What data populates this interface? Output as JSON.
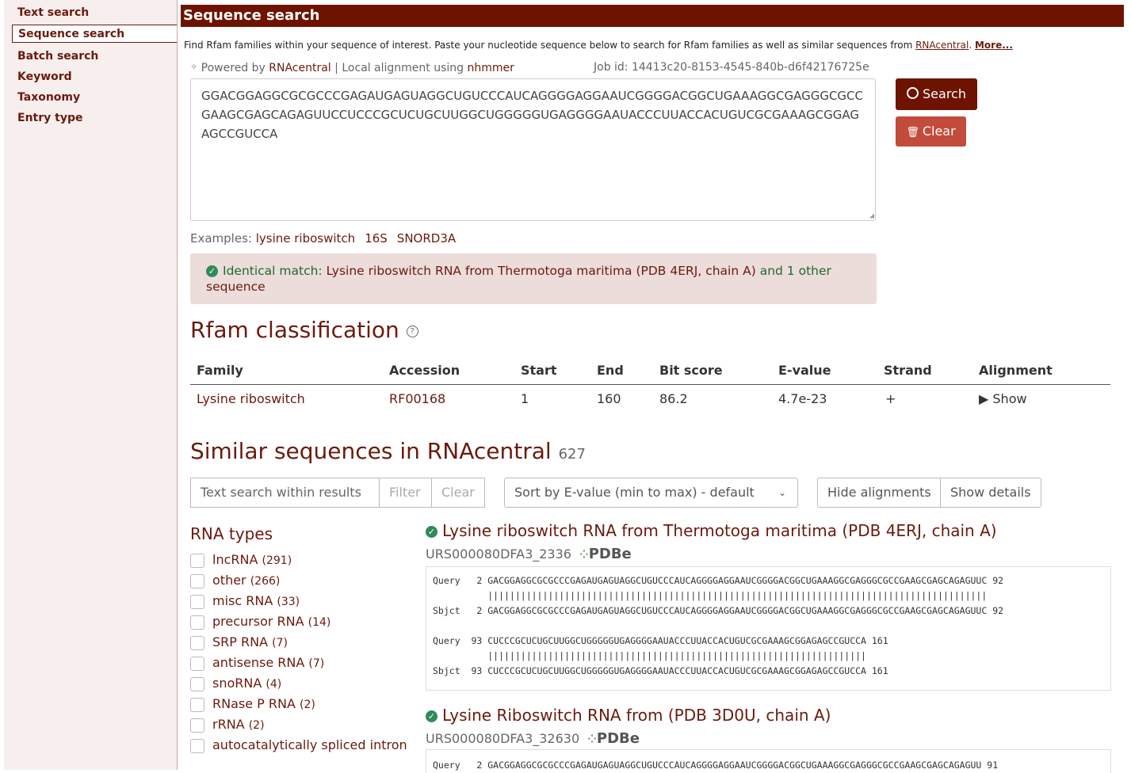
{
  "sidebar": {
    "items": [
      {
        "label": "Text search"
      },
      {
        "label": "Sequence search"
      },
      {
        "label": "Batch search"
      },
      {
        "label": "Keyword"
      },
      {
        "label": "Taxonomy"
      },
      {
        "label": "Entry type"
      }
    ],
    "active_index": 1
  },
  "header": {
    "title": "Sequence search"
  },
  "intro": {
    "text": "Find Rfam families within your sequence of interest. Paste your nucleotide sequence below to search for Rfam families as well as similar sequences from ",
    "link": "RNAcentral",
    "after_link": ". ",
    "more": "More..."
  },
  "powered": {
    "prefix": "Powered by ",
    "rnacentral": "RNAcentral",
    "separator": " | Local alignment using ",
    "nhmmer": "nhmmer"
  },
  "job_id": "Job id: 14413c20-8153-4545-840b-d6f42176725e",
  "sequence_input": {
    "value": "GGACGGAGGCGCGCCCGAGAUGAGUAGGCUGUCCCAUCAGGGGAGGAAUCGGGGACGGCUGAAAGGCGAGGGCGCCGAAGCGAGCAGAGUUCCUCCCGCUCUGCUUGGCUGGGGGUGAGGGGAAUACCCUUACCACUGUCGCGAAAGCGGAGAGCCGUCCA"
  },
  "buttons": {
    "search": "Search",
    "clear": "Clear"
  },
  "examples": {
    "label": "Examples:",
    "items": [
      "lysine riboswitch",
      "16S",
      "SNORD3A"
    ]
  },
  "match": {
    "prefix": "Identical match:",
    "description": "Lysine riboswitch RNA from Thermotoga maritima (PDB 4ERJ, chain A)",
    "suffix": "and 1 other",
    "tail": "sequence"
  },
  "classification": {
    "title": "Rfam classification",
    "columns": [
      "Family",
      "Accession",
      "Start",
      "End",
      "Bit score",
      "E-value",
      "Strand",
      "Alignment"
    ],
    "row": {
      "family": "Lysine riboswitch",
      "accession": "RF00168",
      "start": "1",
      "end": "160",
      "bit_score": "86.2",
      "evalue": "4.7e-23",
      "strand": "+",
      "alignment": "Show"
    }
  },
  "similar": {
    "title": "Similar sequences in RNAcentral",
    "count": "627",
    "search_placeholder": "Text search within results",
    "filter": "Filter",
    "clear": "Clear",
    "sort": "Sort by E-value (min to max) - default",
    "hide_alignments": "Hide alignments",
    "show_details": "Show details"
  },
  "rna_types": {
    "title": "RNA types",
    "items": [
      {
        "label": "lncRNA",
        "count": "(291)"
      },
      {
        "label": "other",
        "count": "(266)"
      },
      {
        "label": "misc RNA",
        "count": "(33)"
      },
      {
        "label": "precursor RNA",
        "count": "(14)"
      },
      {
        "label": "SRP RNA",
        "count": "(7)"
      },
      {
        "label": "antisense RNA",
        "count": "(7)"
      },
      {
        "label": "snoRNA",
        "count": "(4)"
      },
      {
        "label": "RNase P RNA",
        "count": "(2)"
      },
      {
        "label": "rRNA",
        "count": "(2)"
      },
      {
        "label": "autocatalytically spliced intron",
        "count": ""
      }
    ]
  },
  "results": [
    {
      "title": "Lysine riboswitch RNA from Thermotoga maritima (PDB 4ERJ, chain A)",
      "id": "URS000080DFA3_2336",
      "db": "PDBe",
      "alignment": [
        "Query   2 GACGGAGGCGCGCCCGAGAUGAGUAGGCUGUCCCAUCAGGGGAGGAAUCGGGGACGGCUGAAAGGCGAGGGCGCCGAAGCGAGCAGAGUUC 92",
        "          |||||||||||||||||||||||||||||||||||||||||||||||||||||||||||||||||||||||||||||||||||||||||||",
        "Sbjct   2 GACGGAGGCGCGCCCGAGAUGAGUAGGCUGUCCCAUCAGGGGAGGAAUCGGGGACGGCUGAAAGGCGAGGGCGCCGAAGCGAGCAGAGUUC 92",
        "",
        "Query  93 CUCCCGCUCUGCUUGGCUGGGGGUGAGGGGAAUACCCUUACCACUGUCGCGAAAGCGGAGAGCCGUCCA 161",
        "          |||||||||||||||||||||||||||||||||||||||||||||||||||||||||||||||||||||",
        "Sbjct  93 CUCCCGCUCUGCUUGGCUGGGGGUGAGGGGAAUACCCUUACCACUGUCGCGAAAGCGGAGAGCCGUCCA 161"
      ]
    },
    {
      "title": "Lysine Riboswitch RNA from (PDB 3D0U, chain A)",
      "id": "URS000080DFA3_32630",
      "db": "PDBe",
      "alignment": [
        "Query   2 GACGGAGGCGCGCCCGAGAUGAGUAGGCUGUCCCAUCAGGGGAGGAAUCGGGGACGGCUGAAAGGCGAGGGCGCCGAAGCGAGCAGAGUU 91"
      ]
    }
  ],
  "colors": {
    "brand": "#6d1300",
    "accent": "#c24b3c",
    "match_bg": "#ecdcda",
    "check": "#2e8b57"
  }
}
